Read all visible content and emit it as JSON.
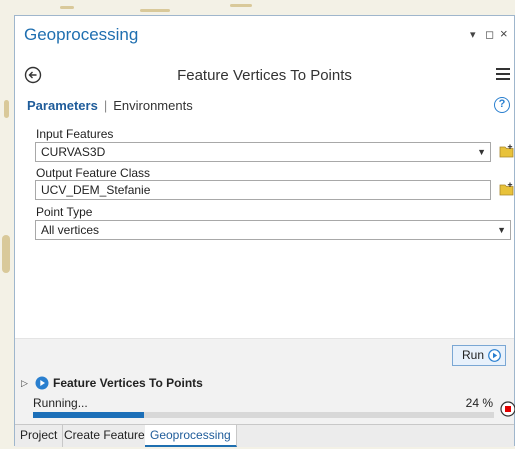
{
  "pane": {
    "title": "Geoprocessing",
    "controls": {
      "pin": "▾",
      "dock": "◻",
      "close": "×"
    }
  },
  "tool": {
    "back_icon": "back-arrow-icon",
    "title": "Feature Vertices To Points",
    "menu_icon": "hamburger-menu-icon"
  },
  "tabs": {
    "parameters": "Parameters",
    "separator": "|",
    "environments": "Environments",
    "help": "?"
  },
  "params": {
    "input_features": {
      "label": "Input Features",
      "value": "CURVAS3D"
    },
    "output_feature_class": {
      "label": "Output Feature Class",
      "value": "UCV_DEM_Stefanie"
    },
    "point_type": {
      "label": "Point Type",
      "value": "All vertices"
    }
  },
  "run": {
    "label": "Run"
  },
  "status": {
    "tool_name": "Feature Vertices To Points",
    "state": "Running...",
    "percent_text": "24 %",
    "progress": 0.24
  },
  "bottom_tabs": [
    {
      "label": "Project"
    },
    {
      "label": "Create Features"
    },
    {
      "label": "Geoprocessing",
      "active": true
    }
  ],
  "colors": {
    "accent": "#1f6fb0",
    "progress_fill": "#1c6fb8",
    "stop_red": "#e00000",
    "folder_yellow": "#e8c23a"
  }
}
